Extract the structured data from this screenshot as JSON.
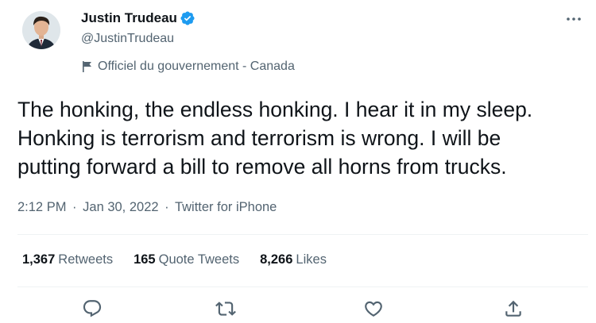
{
  "author": {
    "name": "Justin Trudeau",
    "handle": "@JustinTrudeau",
    "label": "Officiel du gouvernement - Canada"
  },
  "tweet": {
    "text": "The honking, the endless honking. I hear it in my sleep.\nHonking is terrorism and terrorism is wrong. I will be\nputting forward a bill to remove all horns from trucks.",
    "time": "2:12 PM",
    "date": "Jan 30, 2022",
    "source": "Twitter for iPhone"
  },
  "stats": {
    "retweets_count": "1,367",
    "retweets_label": "Retweets",
    "quotes_count": "165",
    "quotes_label": "Quote Tweets",
    "likes_count": "8,266",
    "likes_label": "Likes"
  },
  "separator": "·",
  "colors": {
    "verified": "#1d9bf0",
    "secondary_text": "#536471",
    "primary_text": "#0f1419",
    "divider": "#eff3f4"
  },
  "icons": [
    "verified-badge-icon",
    "more-icon",
    "government-flag-icon",
    "reply-icon",
    "retweet-icon",
    "like-icon",
    "share-icon"
  ]
}
